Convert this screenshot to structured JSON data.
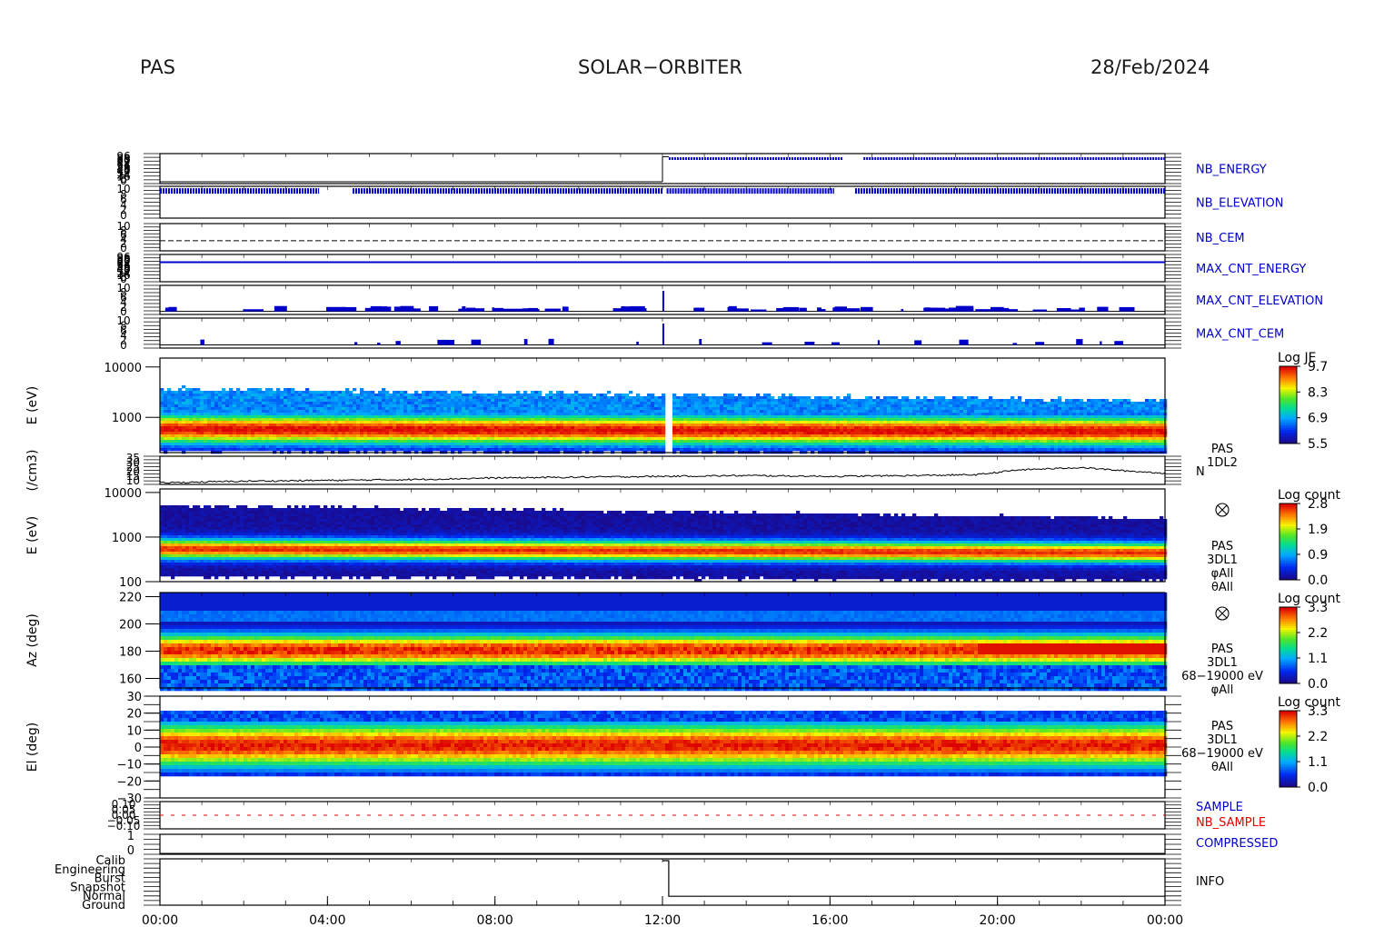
{
  "header": {
    "left": "PAS",
    "center": "SOLAR−ORBITER",
    "right": "28/Feb/2024"
  },
  "colors": {
    "hk_blue": "#0000c8",
    "sample_red": "#e80000",
    "axis": "#000000"
  },
  "colorbars": [
    {
      "title": "Log JE",
      "ticks": [
        "9.7",
        "8.3",
        "6.9",
        "5.5"
      ]
    },
    {
      "title": "Log count",
      "ticks": [
        "2.8",
        "1.9",
        "0.9",
        "0.0"
      ]
    },
    {
      "title": "Log count",
      "ticks": [
        "3.3",
        "2.2",
        "1.1",
        "0.0"
      ]
    },
    {
      "title": "Log count",
      "ticks": [
        "3.3",
        "2.2",
        "1.1",
        "0.0"
      ]
    }
  ],
  "chart_data": {
    "type": "heatmap",
    "x_axis": {
      "range": [
        "00:00",
        "24:00"
      ],
      "tick_labels": [
        "00:00",
        "04:00",
        "08:00",
        "12:00",
        "16:00",
        "20:00",
        "00:00"
      ]
    },
    "panels": [
      {
        "name": "NB_ENERGY",
        "kind": "housekeeping",
        "ytick_text": [
          "96",
          "88",
          "80",
          "72",
          "64",
          "56",
          "48",
          "40",
          "32",
          "24",
          "16",
          "8",
          "0"
        ],
        "level_before_1200": 0.0,
        "level_after_1200": 0.95
      },
      {
        "name": "NB_ELEVATION",
        "kind": "housekeeping",
        "ytick_text": [
          "10",
          "8",
          "6",
          "4",
          "2",
          "0"
        ],
        "level": 0.9,
        "gaps_hours": [
          [
            7.1,
            8.5
          ],
          [
            32.2,
            33.6
          ],
          [
            40.4,
            41.2
          ]
        ]
      },
      {
        "name": "NB_CEM",
        "kind": "housekeeping",
        "ytick_text": [
          "10",
          "8",
          "6",
          "4",
          "2",
          "0"
        ],
        "level": 0.35
      },
      {
        "name": "MAX_CNT_ENERGY",
        "kind": "housekeeping",
        "ytick_text": [
          "96",
          "88",
          "80",
          "72",
          "64",
          "56",
          "48",
          "40",
          "32",
          "24",
          "16",
          "8",
          "0"
        ],
        "level": 0.75
      },
      {
        "name": "MAX_CNT_ELEVATION",
        "kind": "housekeeping",
        "ytick_text": [
          "10",
          "8",
          "6",
          "4",
          "2",
          "0"
        ],
        "level": 0.05
      },
      {
        "name": "MAX_CNT_CEM",
        "kind": "housekeeping",
        "ytick_text": [
          "10",
          "8",
          "6",
          "4",
          "2",
          "0"
        ],
        "level": 0.05
      },
      {
        "ylabel": "E (eV)",
        "kind": "spectrogram",
        "ylog": true,
        "ylim": [
          200,
          15000
        ],
        "yticks": [
          1000,
          10000
        ],
        "ytick_labels": [
          "1000",
          "10000"
        ],
        "colorbar_index": 0,
        "band_center_eV": [
          620,
          560
        ],
        "gap_hours": [
          12.05,
          12.2
        ]
      },
      {
        "ylabel": "(/cm3)",
        "kind": "line",
        "ylim": [
          0,
          35
        ],
        "ytick_labels": [
          "10",
          "15",
          "20",
          "25",
          "30",
          "35"
        ],
        "side_label": [
          "PAS",
          "1DL2"
        ],
        "right_letter": "N",
        "x_hours": [
          0,
          2,
          4,
          6,
          8,
          10,
          12,
          14,
          16,
          18,
          19.5,
          20.5,
          22,
          23,
          24
        ],
        "values": [
          2,
          4,
          5,
          6,
          8,
          9,
          10,
          11,
          10,
          11,
          12,
          18,
          21,
          17,
          14
        ]
      },
      {
        "ylabel": "E (eV)",
        "kind": "spectrogram",
        "ylog": true,
        "ylim": [
          100,
          12000
        ],
        "yticks": [
          100,
          1000,
          10000
        ],
        "ytick_labels": [
          "100",
          "1000",
          "10000"
        ],
        "colorbar_index": 1,
        "side_label": [
          "PAS",
          "3DL1",
          "φAll",
          "θAll"
        ],
        "band_center_eV": [
          580,
          470
        ]
      },
      {
        "ylabel": "Az (deg)",
        "kind": "spectrogram",
        "ylim": [
          153,
          223
        ],
        "yticks": [
          160,
          180,
          200,
          220
        ],
        "ytick_labels": [
          "160",
          "180",
          "200",
          "220"
        ],
        "colorbar_index": 2,
        "side_label": [
          "PAS",
          "3DL1",
          "68−19000 eV",
          "φAll"
        ],
        "peak_deg": 182
      },
      {
        "ylabel": "El (deg)",
        "kind": "spectrogram",
        "ylim": [
          -30,
          30
        ],
        "yticks": [
          -30,
          -20,
          -10,
          0,
          10,
          20,
          30
        ],
        "ytick_labels": [
          "−30",
          "−20",
          "−10",
          "0",
          "10",
          "20",
          "30"
        ],
        "colorbar_index": 3,
        "side_label": [
          "PAS",
          "3DL1",
          "68−19000 eV",
          "θAll"
        ],
        "peak_deg": 2
      },
      {
        "name": "SAMPLE",
        "name2": "NB_SAMPLE",
        "kind": "housekeeping",
        "ytick_text": [
          "0.10",
          "0.05",
          "0.00",
          "−0.05",
          "−0.10"
        ],
        "level": 0.5
      },
      {
        "name": "COMPRESSED",
        "kind": "housekeeping",
        "ytick_labels": [
          "0",
          "1"
        ],
        "level": 0.0
      },
      {
        "name": "INFO",
        "kind": "state",
        "ytick_labels": [
          "Ground",
          "Normal",
          "Snapshot",
          "Burst",
          "Engineering",
          "Calib"
        ],
        "state_before_1200": "Calib",
        "state_after_1200": "Normal",
        "transition_hours": [
          12.0,
          12.15
        ]
      }
    ]
  }
}
